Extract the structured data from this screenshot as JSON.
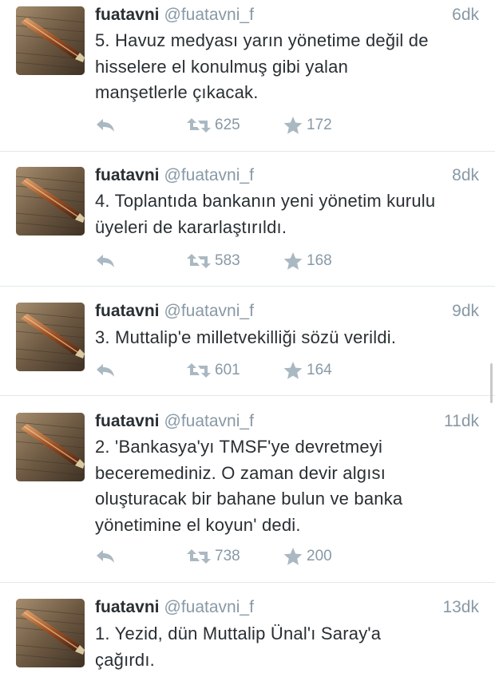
{
  "tweets": [
    {
      "name": "fuatavni",
      "handle": "@fuatavni_f",
      "time": "6dk",
      "lines": [
        "5. Havuz medyası yarın yönetime değil de",
        "hisselere el konulmuş gibi yalan",
        "manşetlerle çıkacak."
      ],
      "retweets": "625",
      "favorites": "172"
    },
    {
      "name": "fuatavni",
      "handle": "@fuatavni_f",
      "time": "8dk",
      "lines": [
        "4. Toplantıda bankanın yeni yönetim kurulu",
        "üyeleri de kararlaştırıldı."
      ],
      "retweets": "583",
      "favorites": "168"
    },
    {
      "name": "fuatavni",
      "handle": "@fuatavni_f",
      "time": "9dk",
      "lines": [
        "3. Muttalip'e milletvekilliği sözü verildi."
      ],
      "retweets": "601",
      "favorites": "164"
    },
    {
      "name": "fuatavni",
      "handle": "@fuatavni_f",
      "time": "11dk",
      "lines": [
        "2. 'Bankasya'yı TMSF'ye devretmeyi",
        "beceremediniz. O zaman devir algısı",
        "oluşturacak bir bahane bulun ve banka",
        "yönetimine el koyun' dedi."
      ],
      "retweets": "738",
      "favorites": "200"
    },
    {
      "name": "fuatavni",
      "handle": "@fuatavni_f",
      "time": "13dk",
      "lines": [
        "1. Yezid, dün Muttalip Ünal'ı Saray'a",
        "çağırdı."
      ]
    }
  ],
  "icons": {
    "reply": "reply-icon",
    "retweet": "retweet-icon",
    "favorite": "star-icon",
    "avatar": "pen-on-paper-avatar"
  },
  "colors": {
    "text": "#292f33",
    "muted": "#8899a6",
    "divider": "#e1e8ed",
    "icon": "#aab8c2"
  }
}
